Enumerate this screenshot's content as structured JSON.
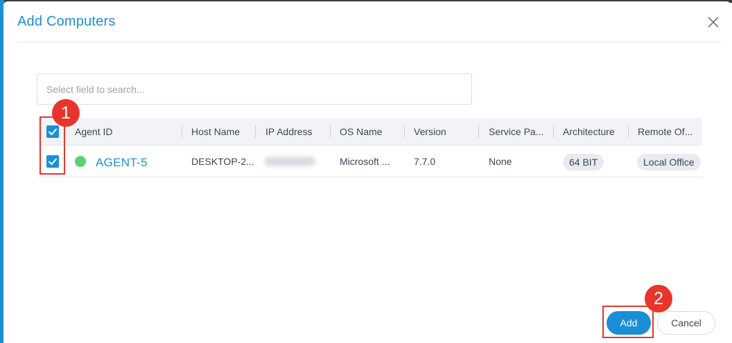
{
  "dialog": {
    "title": "Add Computers",
    "close_icon": "close-icon"
  },
  "search": {
    "placeholder": "Select field to search...",
    "value": ""
  },
  "table": {
    "columns": [
      "Agent ID",
      "Host Name",
      "IP Address",
      "OS Name",
      "Version",
      "Service Pa...",
      "Architecture",
      "Remote Of..."
    ],
    "rows": [
      {
        "selected": true,
        "status": "online",
        "agent_id": "AGENT-5",
        "host_name": "DESKTOP-2...",
        "ip_address": "",
        "os_name": "Microsoft ...",
        "version": "7.7.0",
        "service_pack": "None",
        "architecture": "64 BIT",
        "remote_office": "Local Office"
      }
    ],
    "select_all_checked": true
  },
  "annotations": {
    "step1": "1",
    "step2": "2"
  },
  "footer": {
    "add_label": "Add",
    "cancel_label": "Cancel"
  },
  "colors": {
    "accent": "#1a8fd6",
    "online": "#5fcf74",
    "annotation": "#e8352b"
  }
}
